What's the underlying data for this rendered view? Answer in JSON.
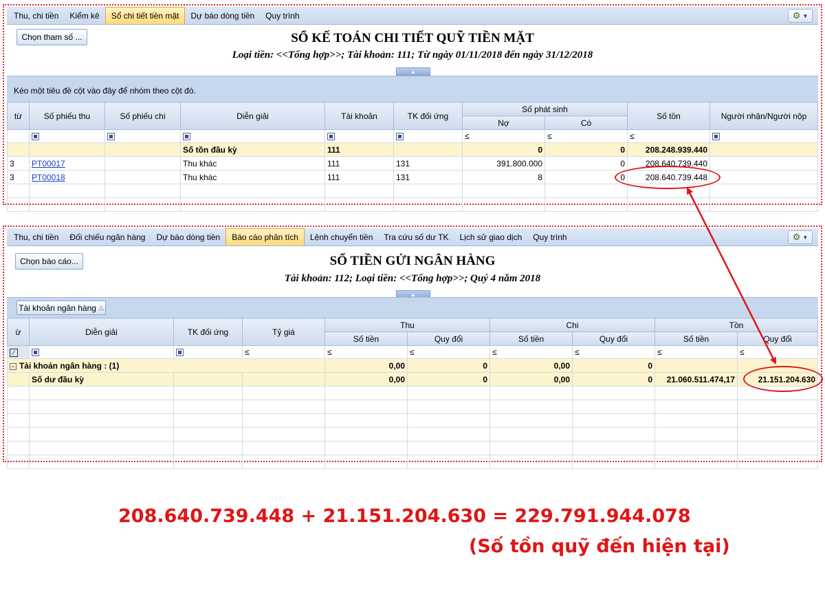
{
  "top": {
    "tabs": [
      "Thu, chi tiền",
      "Kiểm kê",
      "Sổ chi tiết tiền mặt",
      "Dự báo dòng tiền",
      "Quy trình"
    ],
    "active_tab": 2,
    "param_button": "Chọn tham số ...",
    "title": "SỔ KẾ TOÁN CHI TIẾT QUỸ TIỀN MẶT",
    "subtitle": "Loại tiền: <<Tổng hợp>>; Tài khoản: 111; Từ ngày 01/11/2018 đến ngày 31/12/2018",
    "group_hint": "Kéo một tiêu đề cột vào đây để nhóm theo cột đó.",
    "headers": {
      "col0": "từ",
      "receipt_no": "Số phiếu thu",
      "payment_no": "Số phiếu chi",
      "description": "Diễn giải",
      "account": "Tài khoản",
      "counter_account": "TK đối ứng",
      "arising": "Số phát sinh",
      "debit": "Nợ",
      "credit": "Có",
      "balance": "Số tồn",
      "person": "Người nhận/Người nộp"
    },
    "filter_ops": {
      "debit": "≤",
      "credit": "≤",
      "balance": "≤"
    },
    "opening": {
      "label": "Số tồn đầu kỳ",
      "account": "111",
      "debit": "0",
      "credit": "0",
      "balance": "208.248.939.440"
    },
    "rows": [
      {
        "c0": "3",
        "receipt": "PT00017",
        "desc": "Thu khác",
        "acc": "111",
        "cacc": "131",
        "debit": "391.800.000",
        "credit": "0",
        "balance": "208.640.739.440"
      },
      {
        "c0": "3",
        "receipt": "PT00018",
        "desc": "Thu khác",
        "acc": "111",
        "cacc": "131",
        "debit": "8",
        "credit": "0",
        "balance": "208.640.739.448"
      }
    ]
  },
  "bottom": {
    "tabs": [
      "Thu, chi tiền",
      "Đối chiếu ngân hàng",
      "Dự báo dòng tiền",
      "Báo cáo phân tích",
      "Lệnh chuyển tiền",
      "Tra cứu số dư TK",
      "Lịch sử giao dịch",
      "Quy trình"
    ],
    "active_tab": 3,
    "report_button": "Chọn báo cáo...",
    "title": "SỔ TIỀN GỬI NGÂN HÀNG",
    "subtitle": "Tài khoản: 112; Loại tiền: <<Tổng hợp>>; Quý 4 năm 2018",
    "group_chip": "Tài khoản ngân hàng",
    "headers": {
      "col0": "ừ",
      "description": "Diễn giải",
      "counter_account": "TK đối ứng",
      "rate": "Tỷ giá",
      "in": "Thu",
      "out": "Chi",
      "balance": "Tồn",
      "amount": "Số tiền",
      "converted": "Quy đổi"
    },
    "filter_ops": "≤",
    "group_row": {
      "label": "Tài khoản ngân hàng : (1)",
      "in_amount": "0,00",
      "in_conv": "0",
      "out_amount": "0,00",
      "out_conv": "0"
    },
    "opening": {
      "label": "Số dư đầu kỳ",
      "in_amount": "0,00",
      "in_conv": "0",
      "out_amount": "0,00",
      "out_conv": "0",
      "bal_amount": "21.060.511.474,17",
      "bal_conv": "21.151.204.630"
    }
  },
  "annotation": {
    "equation": "208.640.739.448 + 21.151.204.630 = 229.791.944.078",
    "note": "(Số tồn quỹ đến hiện tại)",
    "color": "#e01515"
  }
}
